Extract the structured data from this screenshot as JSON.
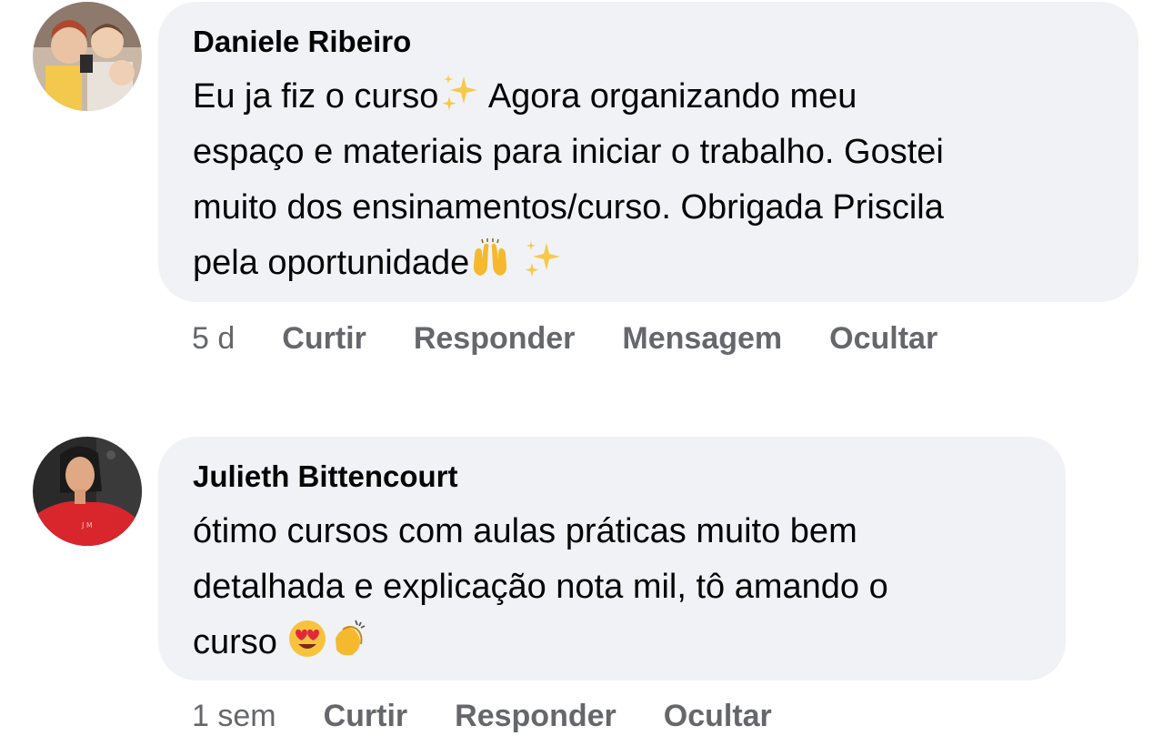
{
  "comments": [
    {
      "author": "Daniele Ribeiro",
      "text_parts": [
        "Eu ja fiz o curso",
        "Agora organizando meu",
        "espaço e materiais para iniciar o trabalho. Gostei",
        "muito dos ensinamentos/curso. Obrigada Priscila",
        "pela oportunidade"
      ],
      "emojis": [
        "sparkles-emoji",
        "raising-hands-emoji",
        "sparkles-emoji"
      ],
      "time": "5 d",
      "actions": [
        "Curtir",
        "Responder",
        "Mensagem",
        "Ocultar"
      ]
    },
    {
      "author": "Julieth Bittencourt",
      "text_parts": [
        "ótimo cursos com aulas práticas muito bem",
        "detalhada e explicação nota mil, tô amando o",
        "curso"
      ],
      "emojis": [
        "heart-eyes-emoji",
        "clapping-hands-emoji"
      ],
      "time": "1 sem",
      "actions": [
        "Curtir",
        "Responder",
        "Ocultar"
      ]
    }
  ],
  "colors": {
    "bubble": "#f0f2f5",
    "meta_text": "#65676b",
    "body_text": "#050505"
  }
}
